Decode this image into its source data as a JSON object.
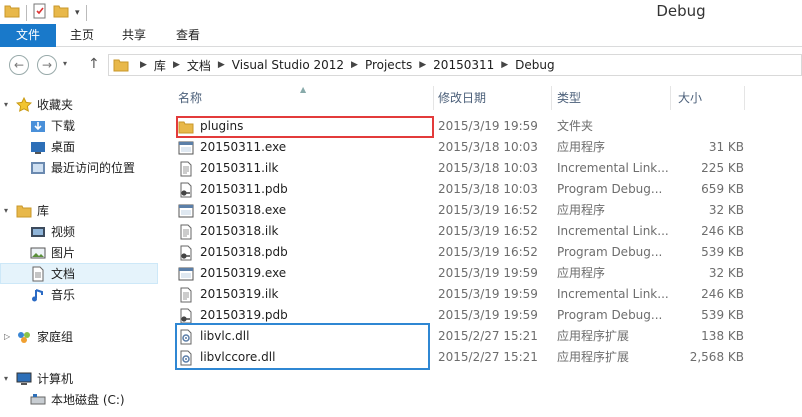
{
  "window": {
    "title": "Debug"
  },
  "ribbon": {
    "tabs": [
      "文件",
      "主页",
      "共享",
      "查看"
    ]
  },
  "address": {
    "crumbs": [
      "库",
      "文档",
      "Visual Studio 2012",
      "Projects",
      "20150311",
      "Debug"
    ]
  },
  "nav": {
    "favorites": "收藏夹",
    "downloads": "下载",
    "desktop": "桌面",
    "recent": "最近访问的位置",
    "libraries": "库",
    "videos": "视频",
    "pictures": "图片",
    "documents": "文档",
    "music": "音乐",
    "homegroup": "家庭组",
    "computer": "计算机",
    "local_disk": "本地磁盘 (C:)"
  },
  "columns": {
    "name": "名称",
    "date": "修改日期",
    "type": "类型",
    "size": "大小"
  },
  "files": [
    {
      "name": "plugins",
      "date": "2015/3/19 19:59",
      "type": "文件夹",
      "size": "",
      "icon": "folder-icon"
    },
    {
      "name": "20150311.exe",
      "date": "2015/3/18 10:03",
      "type": "应用程序",
      "size": "31 KB",
      "icon": "exe-icon"
    },
    {
      "name": "20150311.ilk",
      "date": "2015/3/18 10:03",
      "type": "Incremental Link...",
      "size": "225 KB",
      "icon": "ilk-icon"
    },
    {
      "name": "20150311.pdb",
      "date": "2015/3/18 10:03",
      "type": "Program Debug...",
      "size": "659 KB",
      "icon": "pdb-icon"
    },
    {
      "name": "20150318.exe",
      "date": "2015/3/19 16:52",
      "type": "应用程序",
      "size": "32 KB",
      "icon": "exe-icon"
    },
    {
      "name": "20150318.ilk",
      "date": "2015/3/19 16:52",
      "type": "Incremental Link...",
      "size": "246 KB",
      "icon": "ilk-icon"
    },
    {
      "name": "20150318.pdb",
      "date": "2015/3/19 16:52",
      "type": "Program Debug...",
      "size": "539 KB",
      "icon": "pdb-icon"
    },
    {
      "name": "20150319.exe",
      "date": "2015/3/19 19:59",
      "type": "应用程序",
      "size": "32 KB",
      "icon": "exe-icon"
    },
    {
      "name": "20150319.ilk",
      "date": "2015/3/19 19:59",
      "type": "Incremental Link...",
      "size": "246 KB",
      "icon": "ilk-icon"
    },
    {
      "name": "20150319.pdb",
      "date": "2015/3/19 19:59",
      "type": "Program Debug...",
      "size": "539 KB",
      "icon": "pdb-icon"
    },
    {
      "name": "libvlc.dll",
      "date": "2015/2/27 15:21",
      "type": "应用程序扩展",
      "size": "138 KB",
      "icon": "dll-icon"
    },
    {
      "name": "libvlccore.dll",
      "date": "2015/2/27 15:21",
      "type": "应用程序扩展",
      "size": "2,568 KB",
      "icon": "dll-icon"
    }
  ],
  "colors": {
    "accent": "#1979ca",
    "highlight_red": "#e33b3b",
    "highlight_blue": "#2f87d3"
  }
}
